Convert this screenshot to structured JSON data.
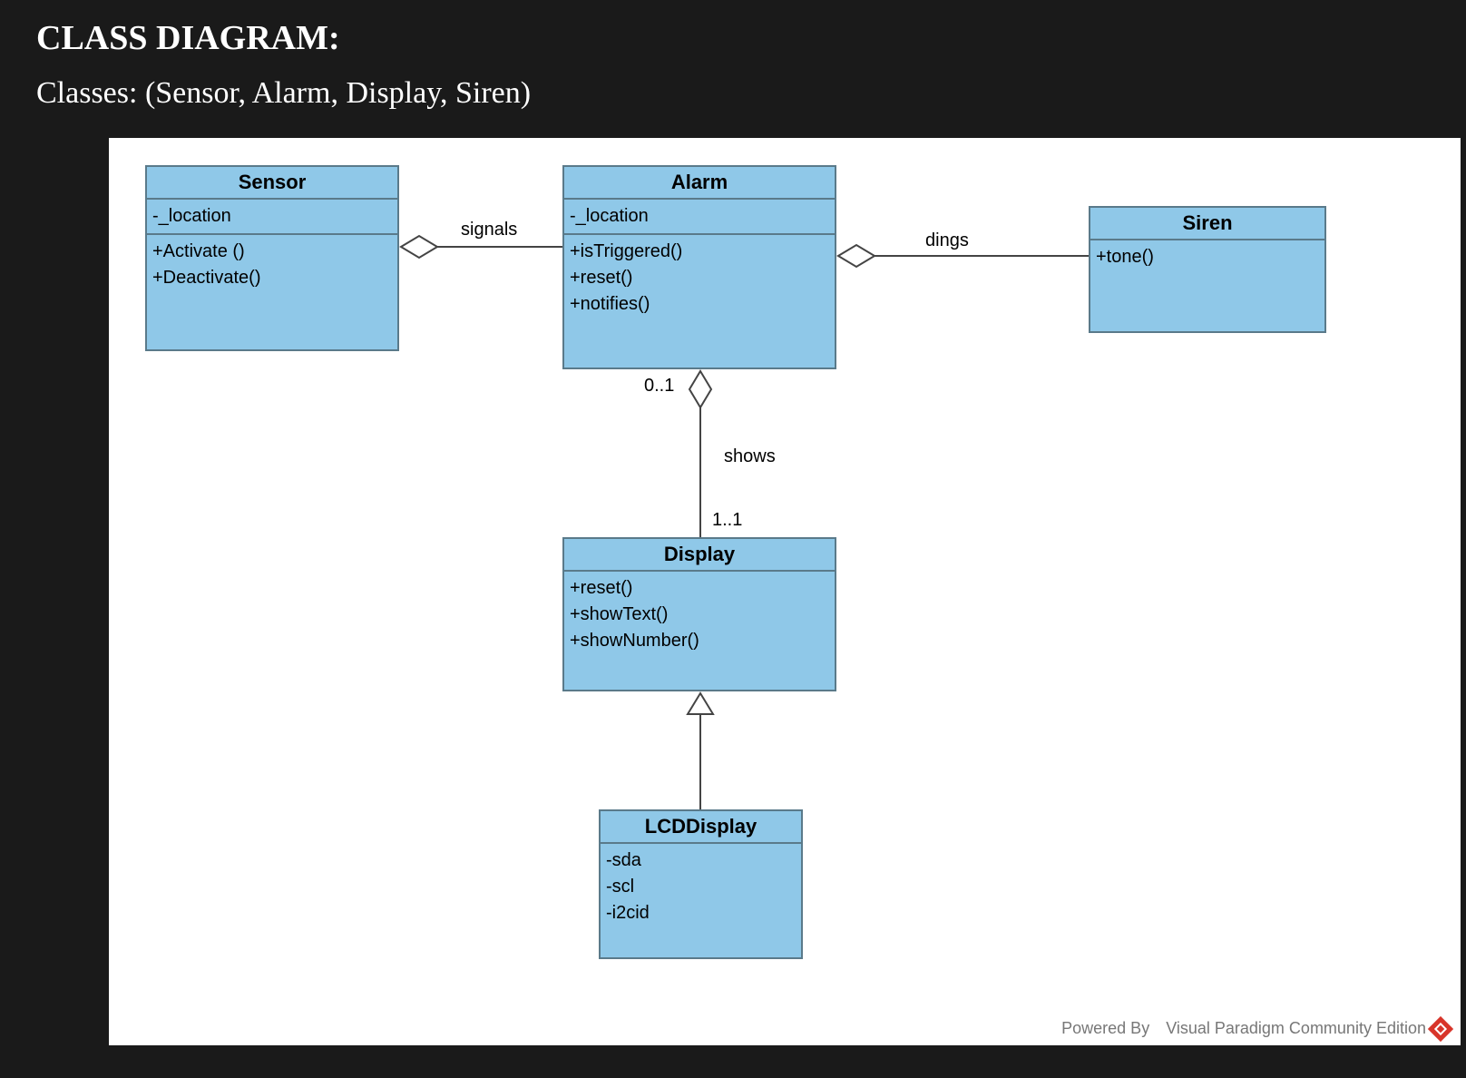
{
  "header": {
    "title": "CLASS DIAGRAM:",
    "subtitle": "Classes: (Sensor, Alarm, Display, Siren)"
  },
  "classes": {
    "sensor": {
      "name": "Sensor",
      "attrs": [
        "-_location"
      ],
      "ops": [
        "+Activate ()",
        "+Deactivate()"
      ]
    },
    "alarm": {
      "name": "Alarm",
      "attrs": [
        "-_location"
      ],
      "ops": [
        "+isTriggered()",
        "+reset()",
        "+notifies()"
      ]
    },
    "siren": {
      "name": "Siren",
      "attrs": [],
      "ops": [
        "+tone()"
      ]
    },
    "display": {
      "name": "Display",
      "attrs": [],
      "ops": [
        "+reset()",
        "+showText()",
        "+showNumber()"
      ]
    },
    "lcd": {
      "name": "LCDDisplay",
      "attrs": [
        "-sda",
        "-scl",
        "-i2cid"
      ],
      "ops": []
    }
  },
  "relations": {
    "signals": {
      "label": "signals"
    },
    "dings": {
      "label": "dings"
    },
    "shows": {
      "label": "shows",
      "m1": "0..1",
      "m2": "1..1"
    }
  },
  "footer": {
    "text": "Powered By Visual Paradigm Community Edition"
  }
}
